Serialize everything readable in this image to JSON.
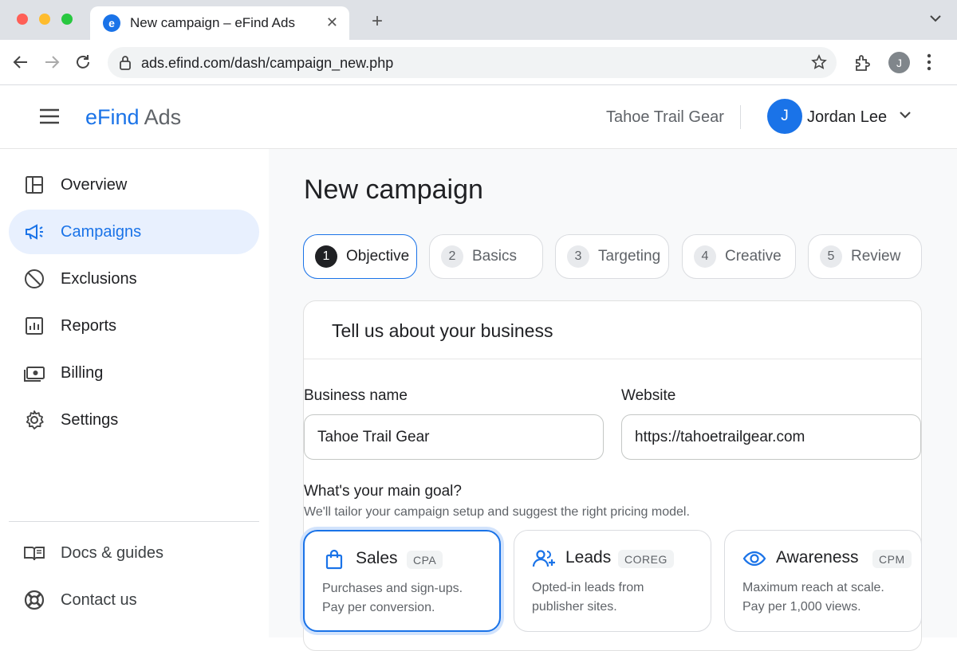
{
  "browser": {
    "tab_title": "New campaign – eFind Ads",
    "favicon_letter": "e",
    "url": "ads.efind.com/dash/campaign_new.php",
    "profile_initial": "J",
    "colors": {
      "close": "#ff5f57",
      "minimize": "#febc2e",
      "maximize": "#28c840"
    }
  },
  "header": {
    "brand_primary": "eFind",
    "brand_secondary": "Ads",
    "company": "Tahoe Trail Gear",
    "user_initial": "J",
    "user_name": "Jordan Lee"
  },
  "sidebar": {
    "items": [
      {
        "label": "Overview",
        "icon": "layout-icon"
      },
      {
        "label": "Campaigns",
        "icon": "megaphone-icon",
        "active": true
      },
      {
        "label": "Exclusions",
        "icon": "block-icon"
      },
      {
        "label": "Reports",
        "icon": "report-icon"
      },
      {
        "label": "Billing",
        "icon": "billing-icon"
      },
      {
        "label": "Settings",
        "icon": "gear-icon"
      }
    ],
    "footer": [
      {
        "label": "Docs & guides",
        "icon": "book-icon"
      },
      {
        "label": "Contact us",
        "icon": "lifebuoy-icon"
      }
    ]
  },
  "main": {
    "title": "New campaign",
    "steps": [
      {
        "num": "1",
        "label": "Objective",
        "active": true
      },
      {
        "num": "2",
        "label": "Basics"
      },
      {
        "num": "3",
        "label": "Targeting"
      },
      {
        "num": "4",
        "label": "Creative"
      },
      {
        "num": "5",
        "label": "Review"
      }
    ],
    "card_title": "Tell us about your business",
    "business_name_label": "Business name",
    "business_name_value": "Tahoe Trail Gear",
    "website_label": "Website",
    "website_value": "https://tahoetrailgear.com",
    "goal_question": "What's your main goal?",
    "goal_help": "We'll tailor your campaign setup and suggest the right pricing model.",
    "goals": [
      {
        "title": "Sales",
        "badge": "CPA",
        "line1": "Purchases and sign-ups.",
        "line2": "Pay per conversion.",
        "selected": true,
        "icon": "shopping-bag-icon"
      },
      {
        "title": "Leads",
        "badge": "COREG",
        "line1": "Opted-in leads from",
        "line2": "publisher sites.",
        "icon": "add-users-icon"
      },
      {
        "title": "Awareness",
        "badge": "CPM",
        "line1": "Maximum reach at scale.",
        "line2": "Pay per 1,000 views.",
        "icon": "eye-icon"
      }
    ],
    "accent_color": "#1a73e8"
  }
}
